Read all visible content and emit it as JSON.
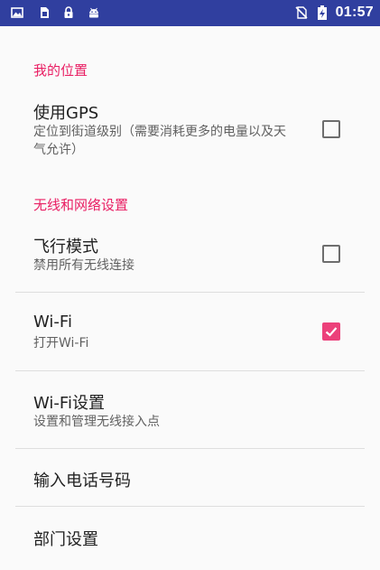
{
  "status_bar": {
    "time": "01:57",
    "icons": [
      "image-icon",
      "sim-card-icon",
      "lock-icon",
      "android-icon",
      "no-sim-icon",
      "battery-charging-icon"
    ],
    "color": "#303f9f"
  },
  "preferences": {
    "accent_color": "#e91e63",
    "location_category": "我的位置",
    "use_gps": {
      "title": "使用GPS",
      "summary": "定位到街道级别（需要消耗更多的电量以及天气允许）",
      "checked": false
    },
    "wireless_category": "无线和网络设置",
    "airplane_mode": {
      "title": "飞行模式",
      "summary": "禁用所有无线连接",
      "checked": false
    },
    "wifi": {
      "title": "Wi-Fi",
      "summary": "打开Wi-Fi",
      "checked": true
    },
    "wifi_settings": {
      "title": "Wi-Fi设置",
      "summary": "设置和管理无线接入点"
    },
    "phone_number": {
      "title": "输入电话号码"
    },
    "department_settings": {
      "title": "部门设置"
    }
  }
}
